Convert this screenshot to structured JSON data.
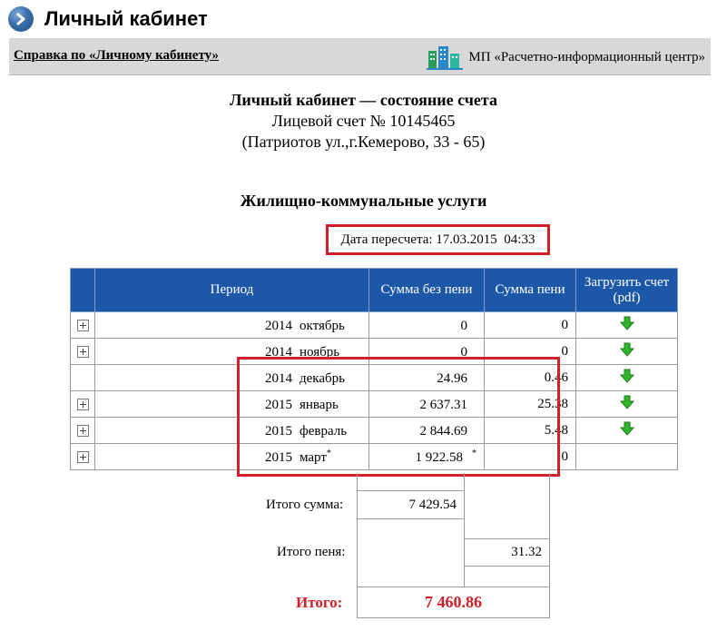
{
  "header": {
    "title": "Личный кабинет",
    "icon": "arrow-right-circle-icon"
  },
  "bar": {
    "help_link": "Справка по «Личному кабинету»",
    "org_name": "МП «Расчетно-информационный центр»"
  },
  "account": {
    "title": "Личный кабинет — состояние счета",
    "number": "Лицевой счет № 10145465",
    "address": "(Патриотов ул.,г.Кемерово, 33 - 65)"
  },
  "section_title": "Жилищно-коммунальные услуги",
  "recalc": "Дата пересчета: 17.03.2015  04:33",
  "table": {
    "headers": {
      "period": "Период",
      "sum": "Сумма без пени",
      "penalty": "Сумма пени",
      "download": "Загрузить счет (pdf)"
    },
    "rows": [
      {
        "year": "2014",
        "month": "октябрь",
        "mark": "",
        "sum": "0",
        "sum_mark": "",
        "penalty": "0",
        "expandable": true,
        "download": true
      },
      {
        "year": "2014",
        "month": "ноябрь",
        "mark": "",
        "sum": "0",
        "sum_mark": "",
        "penalty": "0",
        "expandable": true,
        "download": true
      },
      {
        "year": "2014",
        "month": "декабрь",
        "mark": "",
        "sum": "24.96",
        "sum_mark": "",
        "penalty": "0.46",
        "expandable": false,
        "download": true
      },
      {
        "year": "2015",
        "month": "январь",
        "mark": "",
        "sum": "2 637.31",
        "sum_mark": "",
        "penalty": "25.38",
        "expandable": true,
        "download": true
      },
      {
        "year": "2015",
        "month": "февраль",
        "mark": "",
        "sum": "2 844.69",
        "sum_mark": "",
        "penalty": "5.48",
        "expandable": true,
        "download": true
      },
      {
        "year": "2015",
        "month": "март",
        "mark": "*",
        "sum": "1 922.58",
        "sum_mark": "*",
        "penalty": "0",
        "expandable": true,
        "download": false
      }
    ]
  },
  "totals": {
    "sum_label": "Итого сумма:",
    "sum_value": "7 429.54",
    "penalty_label": "Итого пеня:",
    "penalty_value": "31.32",
    "grand_label": "Итого:",
    "grand_value": "7 460.86"
  },
  "colors": {
    "accent_red": "#d0202a",
    "header_blue": "#1d57a8",
    "download_green": "#2fb52b"
  }
}
